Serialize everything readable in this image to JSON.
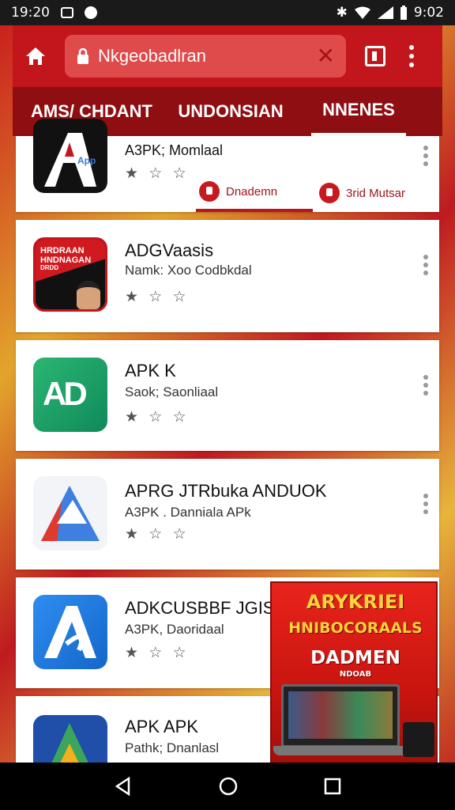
{
  "status": {
    "time": "19:20",
    "clock": "9:02"
  },
  "appbar": {
    "url_text": "Nkgeobadlran"
  },
  "tabs": [
    {
      "label": "AMS/ CHDANT"
    },
    {
      "label": "UNDONSIAN"
    },
    {
      "label": "NNENES"
    }
  ],
  "apps": [
    {
      "title": "A3PK; Momlaal",
      "popup": {
        "btn1": "Dnademn",
        "btn2": "3rid Mutsar"
      },
      "icon_badge": "App"
    },
    {
      "title": "ADGVaasis",
      "subtitle": "Namk: Xoo Codbkdal",
      "icon_text": [
        "HRDRAAN",
        "HNDNAGAN",
        "DRDD"
      ]
    },
    {
      "title": "APK K",
      "subtitle": "Saok; Saonliaal",
      "icon_text": "AD"
    },
    {
      "title": "APRG JTRbuka ANDUOK",
      "subtitle": "A3PK . Danniala APk"
    },
    {
      "title": "ADKCUSBBF JGISI",
      "subtitle": "A3PK, Daoridaal"
    },
    {
      "title": "APK APK",
      "subtitle": "Pathk; Dnanlasl"
    }
  ],
  "ad": {
    "line1": "ARYKRIEI",
    "line2": "HNIBOCORAALS",
    "line3": "DADMEN",
    "line4": "NDOAB"
  },
  "stars": "★ ☆ ☆",
  "colors": {
    "brand_red": "#c2161c",
    "tab_dark": "#8f0e12",
    "yellow": "#e2a52c"
  }
}
